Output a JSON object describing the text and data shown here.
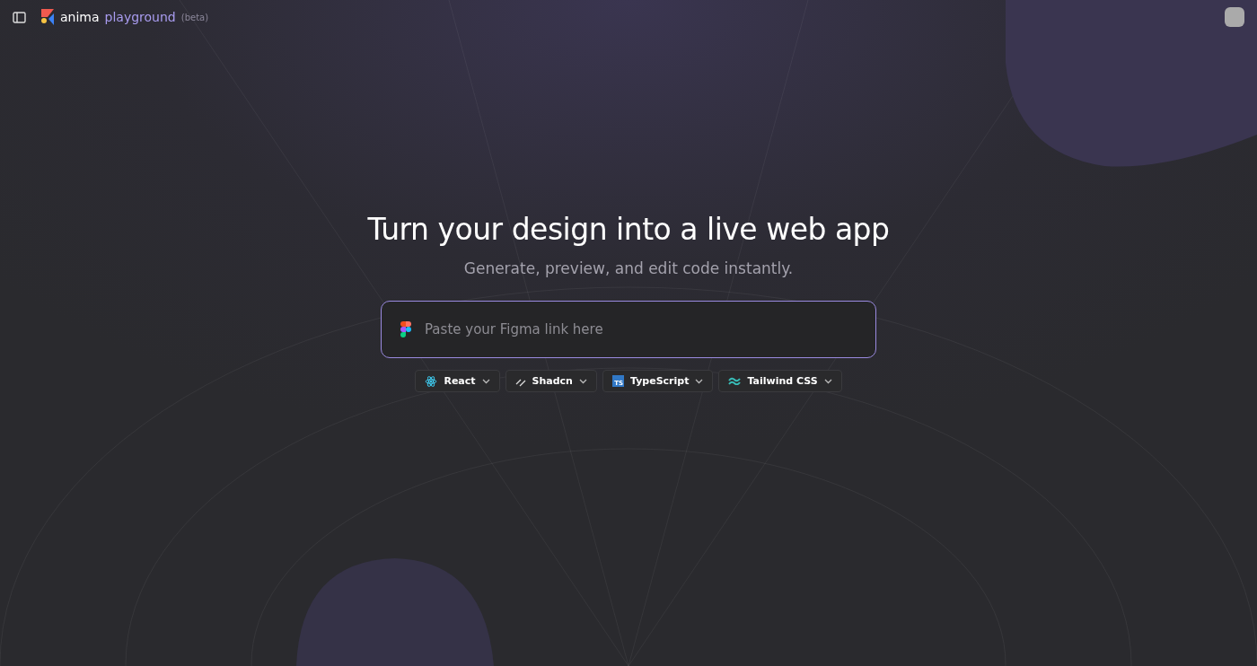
{
  "header": {
    "brand": "anima",
    "product": "playground",
    "tag": "(beta)"
  },
  "hero": {
    "title": "Turn your design into a live web app",
    "subtitle": "Generate, preview, and edit code instantly."
  },
  "link_input": {
    "placeholder": "Paste your Figma link here"
  },
  "options": [
    {
      "kind": "react",
      "label": "React"
    },
    {
      "kind": "shadcn",
      "label": "Shadcn"
    },
    {
      "kind": "typescript",
      "label": "TypeScript",
      "badge": "TS"
    },
    {
      "kind": "tailwind",
      "label": "Tailwind CSS"
    }
  ]
}
